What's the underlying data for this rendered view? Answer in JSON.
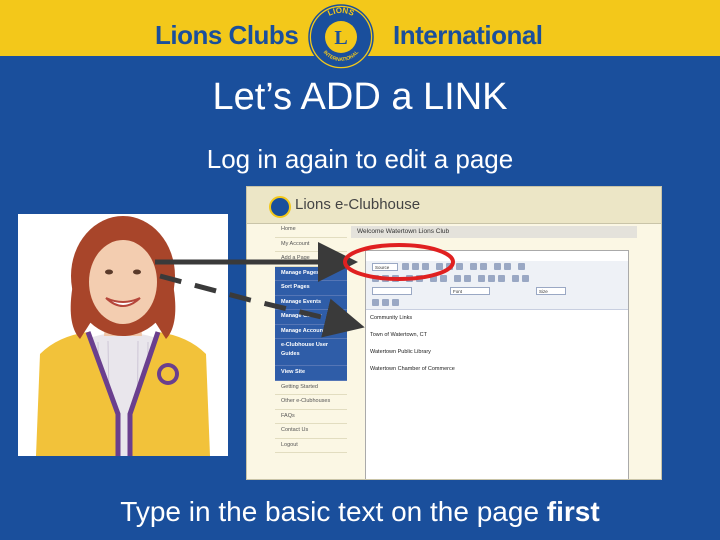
{
  "header": {
    "brand_left": "Lions Clubs",
    "brand_right": "International",
    "logo_top_text": "LIONS",
    "logo_bottom_text": "INTERNATIONAL",
    "logo_letter": "L"
  },
  "slide": {
    "title": "Let’s ADD a LINK",
    "subtitle": "Log in again to edit a page",
    "footer_text": "Type in the basic text on the page ",
    "footer_bold": "first"
  },
  "screenshot": {
    "app_title": "Lions e-Clubhouse",
    "nav_items": [
      {
        "label": "Home",
        "active": false
      },
      {
        "label": "My Account",
        "active": false
      },
      {
        "label": "Add a Page",
        "active": false
      },
      {
        "label": "Manage Pages",
        "active": true
      },
      {
        "label": "Sort Pages",
        "active": true
      },
      {
        "label": "Manage Events",
        "active": true
      },
      {
        "label": "Manage Gallery",
        "active": true
      },
      {
        "label": "Manage Accounts",
        "active": true
      },
      {
        "label": "e-Clubhouse User Guides",
        "active": true,
        "tall": true
      },
      {
        "label": "View Site",
        "active": true
      },
      {
        "label": "Getting Started",
        "active": false
      },
      {
        "label": "Other e-Clubhouses",
        "active": false
      },
      {
        "label": "FAQs",
        "active": false
      },
      {
        "label": "Contact Us",
        "active": false
      },
      {
        "label": "Logout",
        "active": false
      }
    ],
    "content_title": "Welcome Watertown Lions Club",
    "format_select": "Community Links",
    "font_select": "Font",
    "size_select": "Size",
    "toolbar_text": "Source",
    "editor_lines": [
      "Community Links",
      "Town of Watertown, CT",
      "Watertown Public Library",
      "Watertown Chamber of Commerce"
    ]
  },
  "colors": {
    "background": "#1a4f9c",
    "banner": "#f3c81a",
    "highlight_circle": "#e02020",
    "arrow": "#3a3a3a"
  }
}
